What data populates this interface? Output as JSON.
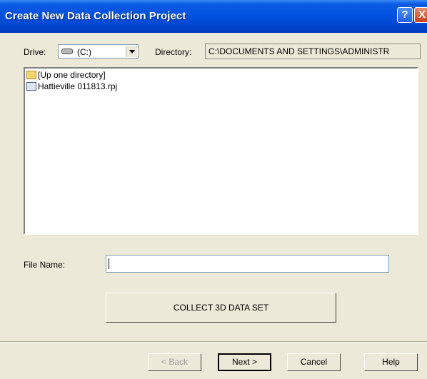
{
  "window": {
    "title": "Create New Data Collection Project",
    "help_glyph": "?",
    "close_glyph": "X"
  },
  "drive": {
    "label": "Drive:",
    "value": "(C:)"
  },
  "directory": {
    "label": "Directory:",
    "value": "C:\\DOCUMENTS AND SETTINGS\\ADMINISTR"
  },
  "files": [
    {
      "name": "[Up one directory]",
      "icon": "folder-icon"
    },
    {
      "name": "Hattieville 011813.rpj",
      "icon": "project-file-icon"
    }
  ],
  "file_name": {
    "label": "File Name:",
    "value": ""
  },
  "collect_button": "COLLECT 3D DATA SET",
  "buttons": {
    "back": "< Back",
    "next": "Next >",
    "cancel": "Cancel",
    "help": "Help"
  }
}
